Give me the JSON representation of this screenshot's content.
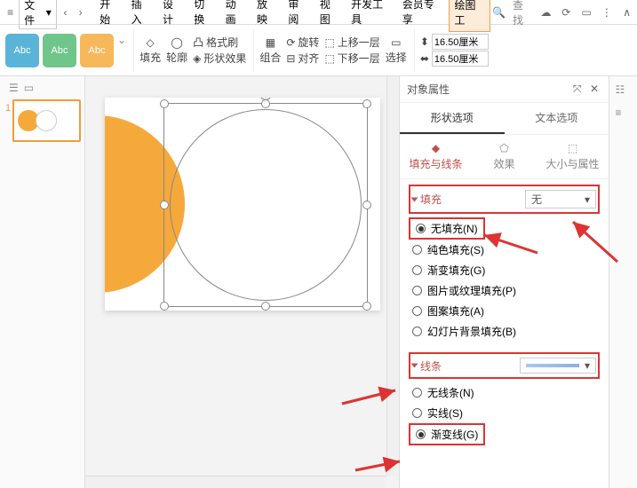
{
  "menu": {
    "file": "文件",
    "tabs": [
      "开始",
      "插入",
      "设计",
      "切换",
      "动画",
      "放映",
      "审阅",
      "视图",
      "开发工具",
      "会员专享",
      "绘图工"
    ],
    "search": "查找"
  },
  "ribbon": {
    "abc": "Abc",
    "fill": "填充",
    "outline": "轮廓",
    "format_painter": "格式刷",
    "shape_effect": "形状效果",
    "group": "组合",
    "rotate": "旋转",
    "align": "对齐",
    "up": "上移一层",
    "down": "下移一层",
    "select": "选择",
    "height": "16.50厘米",
    "width": "16.50厘米"
  },
  "slides": {
    "num1": "1"
  },
  "panel": {
    "title": "对象属性",
    "tab_shape": "形状选项",
    "tab_text": "文本选项",
    "sub_fill": "填充与线条",
    "sub_effect": "效果",
    "sub_size": "大小与属性",
    "sec_fill": "填充",
    "fill_none_sel": "无",
    "fill_none": "无填充(N)",
    "fill_solid": "纯色填充(S)",
    "fill_gradient": "渐变填充(G)",
    "fill_picture": "图片或纹理填充(P)",
    "fill_pattern": "图案填充(A)",
    "fill_slidebg": "幻灯片背景填充(B)",
    "sec_line": "线条",
    "line_none": "无线条(N)",
    "line_solid": "实线(S)",
    "line_gradient": "渐变线(G)"
  }
}
